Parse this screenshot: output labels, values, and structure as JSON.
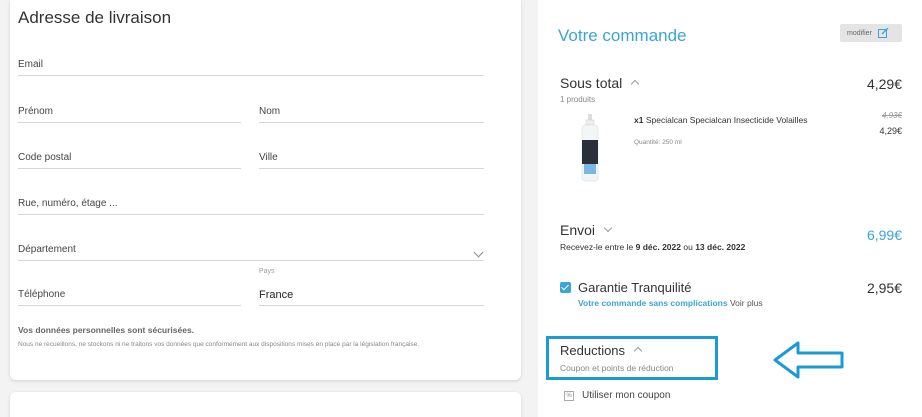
{
  "shipping": {
    "title": "Adresse de livraison",
    "email": "Email",
    "firstname": "Prénom",
    "lastname": "Nom",
    "postal_code": "Code postal",
    "city": "Ville",
    "street": "Rue, numéro, étage ...",
    "department": "Département",
    "phone": "Téléphone",
    "country_label": "Pays",
    "country_value": "France",
    "privacy_title": "Vos données personnelles sont sécurisées.",
    "privacy_text": "Nous ne recueillons, ne stockons ni ne traitons vos données que conformément aux dispositions mises en place par la législation française."
  },
  "order": {
    "title": "Votre commande",
    "modify_label": "modifier",
    "subtotal_label": "Sous total",
    "subtotal_count": "1 produits",
    "subtotal_price": "4,29€",
    "product": {
      "qty_prefix": "x1",
      "name": "Specialcan Specialcan Insecticide Volailles",
      "quantity": "Quantité: 250 ml",
      "old_price": "4,93€",
      "price": "4,29€"
    },
    "shipping_label": "Envoi",
    "delivery_prefix": "Recevez-le entre le",
    "delivery_from": "9 déc. 2022",
    "delivery_and": "ou",
    "delivery_to": "13 déc. 2022",
    "shipping_price": "6,99€",
    "guarantee_label": "Garantie Tranquilité",
    "guarantee_price": "2,95€",
    "guarantee_sub": "Votre commande sans complications",
    "guarantee_more": "Voir plus",
    "reductions_label": "Reductions",
    "reductions_sub": "Coupon et points de réduction",
    "coupon_label": "Utiliser mon coupon"
  },
  "colors": {
    "accent": "#3aa5d6",
    "highlight": "#1c9ad6"
  }
}
